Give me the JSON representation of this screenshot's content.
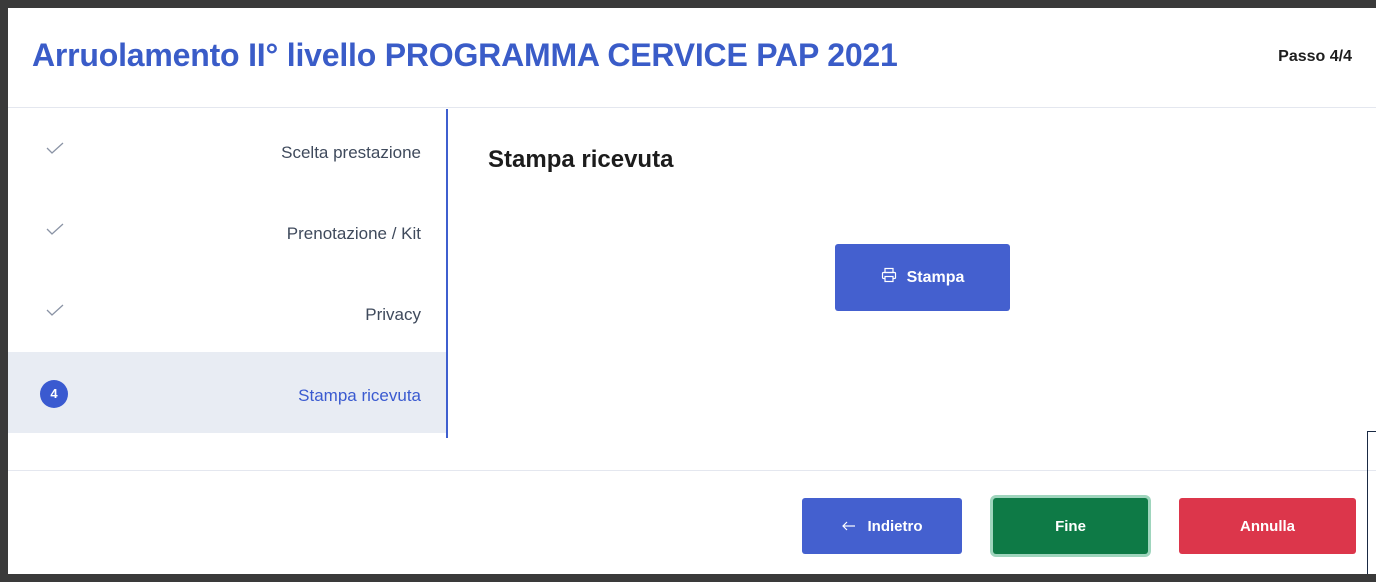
{
  "header": {
    "title": "Arruolamento II° livello PROGRAMMA CERVICE PAP 2021",
    "step_counter": "Passo 4/4"
  },
  "sidebar": {
    "steps": [
      {
        "label": "Scelta prestazione",
        "status": "completed",
        "icon": "check-icon"
      },
      {
        "label": "Prenotazione / Kit",
        "status": "completed",
        "icon": "check-icon"
      },
      {
        "label": "Privacy",
        "status": "completed",
        "icon": "check-icon"
      },
      {
        "label": "Stampa ricevuta",
        "status": "active",
        "number": "4"
      }
    ]
  },
  "main": {
    "section_title": "Stampa ricevuta",
    "print_button": {
      "label": "Stampa",
      "icon": "printer-icon"
    }
  },
  "footer": {
    "back_label": "Indietro",
    "back_icon": "arrow-left-icon",
    "finish_label": "Fine",
    "cancel_label": "Annulla"
  },
  "colors": {
    "title": "#3a5cc8",
    "primary": "#4460cf",
    "success": "#0e7a46",
    "danger": "#dc364b",
    "active_step_bg": "#e8ecf3"
  }
}
